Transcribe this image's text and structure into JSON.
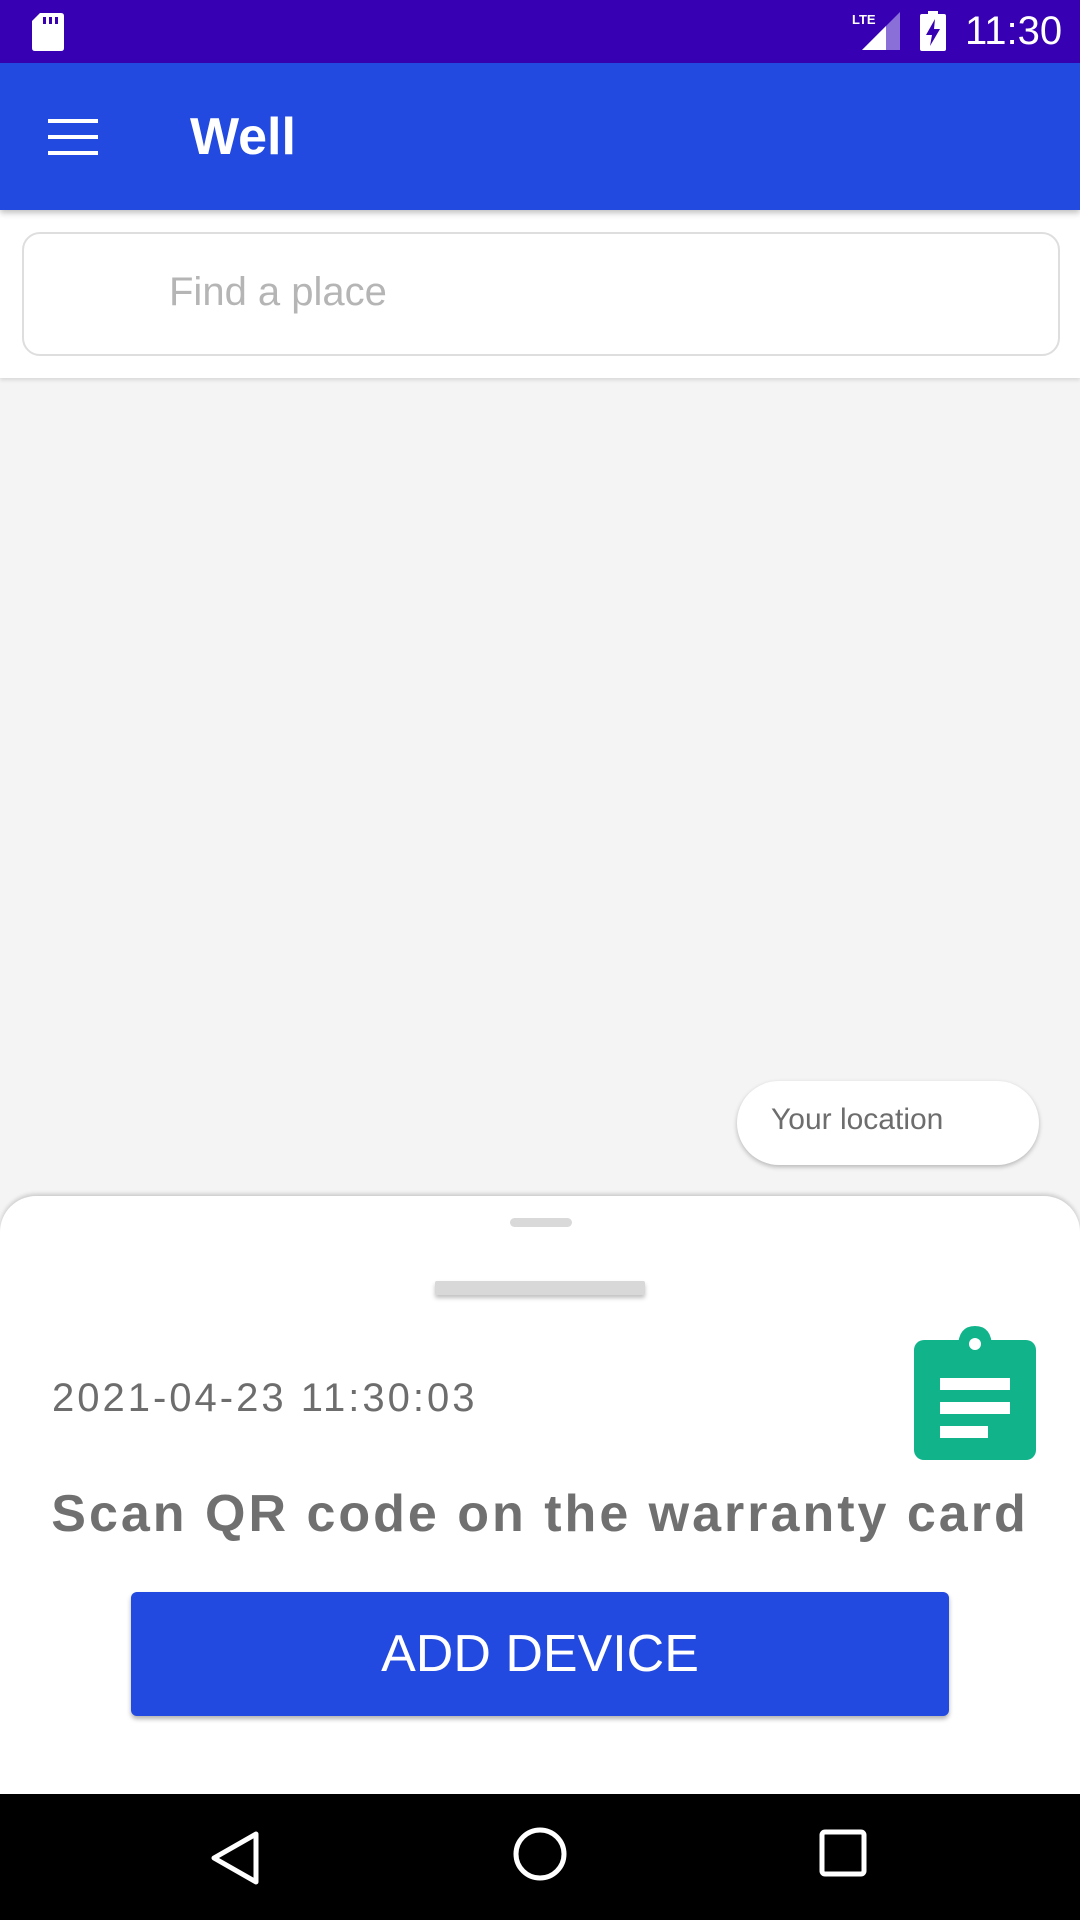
{
  "status_bar": {
    "time": "11:30",
    "network": "LTE",
    "icons": [
      "sd-card-icon",
      "lte-signal-icon",
      "battery-charging-icon"
    ]
  },
  "app_bar": {
    "title": "Well",
    "menu_icon": "hamburger-menu-icon"
  },
  "search": {
    "placeholder": "Find a place"
  },
  "map": {
    "location_chip": "Your location"
  },
  "bottom_sheet": {
    "timestamp": "2021-04-23 11:30:03",
    "instruction": "Scan QR code on the warranty card",
    "add_button": "ADD DEVICE",
    "clipboard_icon": "clipboard-list-icon"
  },
  "nav_bar": {
    "icons": [
      "back-icon",
      "home-icon",
      "recent-apps-icon"
    ]
  },
  "colors": {
    "status_bar": "#3700b3",
    "primary": "#2249e0",
    "clipboard": "#10b38a",
    "text_gray": "#707070"
  }
}
